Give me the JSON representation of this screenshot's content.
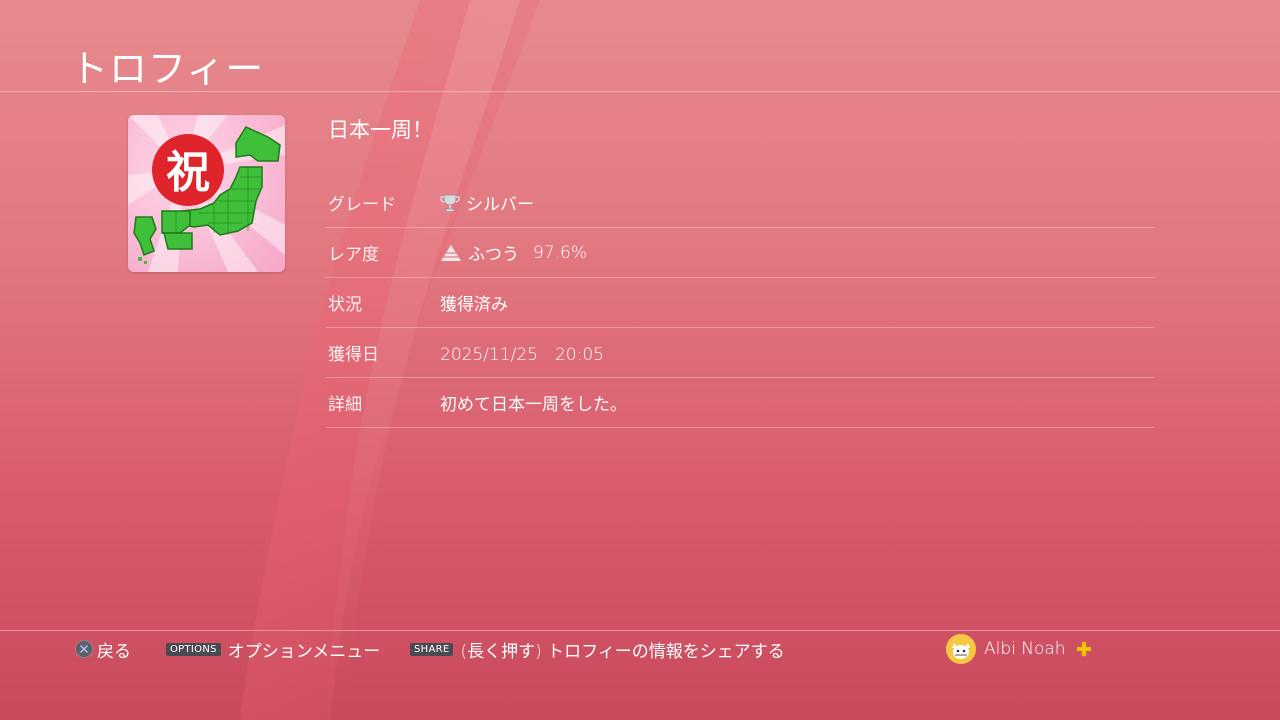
{
  "header": {
    "title": "トロフィー"
  },
  "trophy": {
    "name": "日本一周！",
    "icon": "japan-map-celebration-icon",
    "stamp_text": "祝",
    "details": [
      {
        "label": "グレード",
        "value": "シルバー",
        "icon": "silver-trophy-icon"
      },
      {
        "label": "レア度",
        "value": "ふつう",
        "extra": "97.6%",
        "icon": "rarity-pyramid-icon"
      },
      {
        "label": "状況",
        "value": "獲得済み"
      },
      {
        "label": "獲得日",
        "value": "2025/11/25　20:05"
      },
      {
        "label": "詳細",
        "value": "初めて日本一周をした。"
      }
    ]
  },
  "footer": {
    "back": {
      "button": "cross-button-icon",
      "label": "戻る"
    },
    "options": {
      "tag": "OPTIONS",
      "label": "オプションメニュー"
    },
    "share": {
      "tag": "SHARE",
      "label": "(長く押す) トロフィーの情報をシェアする"
    },
    "user": {
      "name": "Albi Noah",
      "badge": "ps-plus-icon"
    }
  },
  "colors": {
    "background_top": "#e68a8e",
    "background_bottom": "#c84a5d",
    "map_green": "#3fbf3a",
    "stamp_red": "#e0242c",
    "plus_gold": "#f2c511"
  }
}
